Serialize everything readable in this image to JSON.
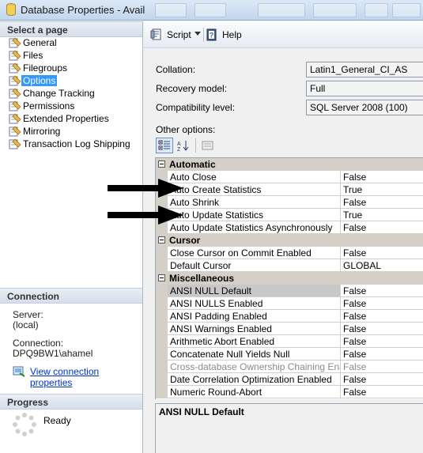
{
  "window": {
    "title": "Database Properties - Avail"
  },
  "left": {
    "select_page_heading": "Select a page",
    "pages": [
      {
        "label": "General",
        "selected": false
      },
      {
        "label": "Files",
        "selected": false
      },
      {
        "label": "Filegroups",
        "selected": false
      },
      {
        "label": "Options",
        "selected": true
      },
      {
        "label": "Change Tracking",
        "selected": false
      },
      {
        "label": "Permissions",
        "selected": false
      },
      {
        "label": "Extended Properties",
        "selected": false
      },
      {
        "label": "Mirroring",
        "selected": false
      },
      {
        "label": "Transaction Log Shipping",
        "selected": false
      }
    ],
    "connection_heading": "Connection",
    "server_label": "Server:",
    "server_value": "(local)",
    "connection_label": "Connection:",
    "connection_value": "DPQ9BW1\\ahamel",
    "view_connection_link": "View connection properties",
    "progress_heading": "Progress",
    "progress_status": "Ready"
  },
  "toolbar": {
    "script_label": "Script",
    "help_label": "Help"
  },
  "form": {
    "collation_label": "Collation:",
    "collation_value": "Latin1_General_CI_AS",
    "recovery_label": "Recovery model:",
    "recovery_value": "Full",
    "compat_label": "Compatibility level:",
    "compat_value": "SQL Server 2008 (100)",
    "other_options_label": "Other options:"
  },
  "grid": {
    "categories": [
      {
        "name": "Automatic",
        "rows": [
          {
            "name": "Auto Close",
            "value": "False"
          },
          {
            "name": "Auto Create Statistics",
            "value": "True"
          },
          {
            "name": "Auto Shrink",
            "value": "False"
          },
          {
            "name": "Auto Update Statistics",
            "value": "True"
          },
          {
            "name": "Auto Update Statistics Asynchronously",
            "value": "False"
          }
        ]
      },
      {
        "name": "Cursor",
        "rows": [
          {
            "name": "Close Cursor on Commit Enabled",
            "value": "False"
          },
          {
            "name": "Default Cursor",
            "value": "GLOBAL"
          }
        ]
      },
      {
        "name": "Miscellaneous",
        "rows": [
          {
            "name": "ANSI NULL Default",
            "value": "False",
            "selected": true
          },
          {
            "name": "ANSI NULLS Enabled",
            "value": "False"
          },
          {
            "name": "ANSI Padding Enabled",
            "value": "False"
          },
          {
            "name": "ANSI Warnings Enabled",
            "value": "False"
          },
          {
            "name": "Arithmetic Abort Enabled",
            "value": "False"
          },
          {
            "name": "Concatenate Null Yields Null",
            "value": "False"
          },
          {
            "name": "Cross-database Ownership Chaining Enabled",
            "value": "False",
            "disabled": true
          },
          {
            "name": "Date Correlation Optimization Enabled",
            "value": "False"
          },
          {
            "name": "Numeric Round-Abort",
            "value": "False"
          }
        ]
      }
    ],
    "description_title": "ANSI NULL Default"
  },
  "colors": {
    "selection": "#3399ff",
    "link": "#0033cc",
    "category_bg": "#d4d0c8"
  }
}
